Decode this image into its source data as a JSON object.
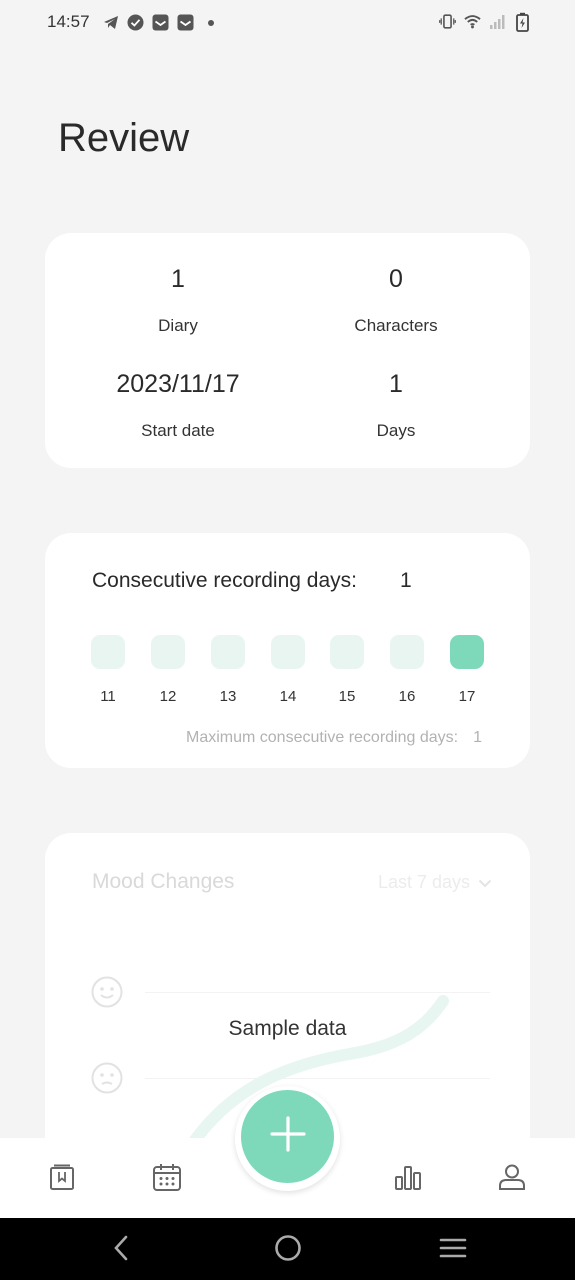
{
  "status_bar": {
    "time": "14:57",
    "left_icons": [
      "telegram-icon",
      "check-circle-icon",
      "gmail-icon",
      "gmail-icon",
      "dot-icon"
    ],
    "right_icons": [
      "vibrate-icon",
      "wifi-icon",
      "signal-icon",
      "battery-charging-icon"
    ]
  },
  "page": {
    "title": "Review"
  },
  "stats": {
    "diary_value": "1",
    "diary_label": "Diary",
    "characters_value": "0",
    "characters_label": "Characters",
    "start_date_value": "2023/11/17",
    "start_date_label": "Start date",
    "days_value": "1",
    "days_label": "Days"
  },
  "streak": {
    "title": "Consecutive recording days:",
    "count": "1",
    "days": [
      {
        "label": "11",
        "recorded": false
      },
      {
        "label": "12",
        "recorded": false
      },
      {
        "label": "13",
        "recorded": false
      },
      {
        "label": "14",
        "recorded": false
      },
      {
        "label": "15",
        "recorded": false
      },
      {
        "label": "16",
        "recorded": false
      },
      {
        "label": "17",
        "recorded": true
      }
    ],
    "max_label": "Maximum consecutive recording days:",
    "max_value": "1"
  },
  "mood": {
    "title": "Mood Changes",
    "range": "Last 7 days",
    "sample_label": "Sample data"
  },
  "bottom_nav": {
    "items": [
      "diary-book-icon",
      "calendar-icon",
      "add-icon",
      "chart-icon",
      "profile-icon"
    ],
    "fab_icon": "plus-icon"
  },
  "system_nav": [
    "back-icon",
    "home-icon",
    "recents-icon"
  ],
  "colors": {
    "accent": "#7ed9bb",
    "accent_light": "#e8f5f1",
    "background": "#f4f4f4",
    "card": "#ffffff"
  }
}
